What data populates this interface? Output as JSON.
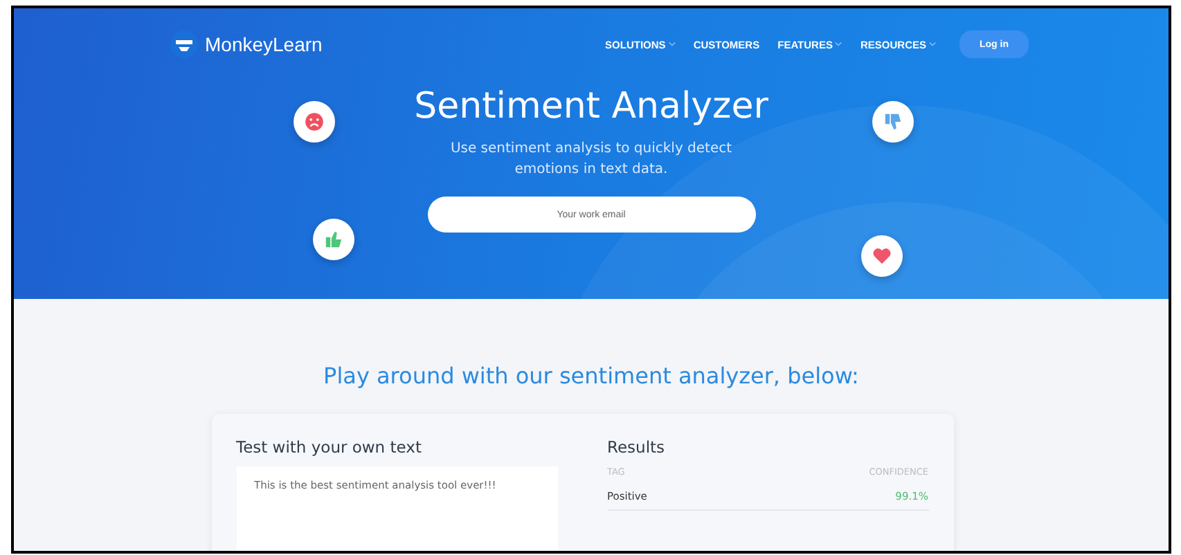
{
  "header": {
    "logo": "MonkeyLearn",
    "nav": [
      {
        "label": "SOLUTIONS",
        "kind": "dropdown"
      },
      {
        "label": "CUSTOMERS",
        "kind": "link"
      },
      {
        "label": "FEATURES",
        "kind": "dropdown"
      },
      {
        "label": "RESOURCES",
        "kind": "dropdown"
      }
    ],
    "login": "Log in"
  },
  "hero": {
    "title": "Sentiment Analyzer",
    "subtitle": "Use sentiment analysis to quickly detect emotions in text data.",
    "email": {
      "placeholder": "Your work email"
    },
    "badges": [
      {
        "kind": "sad"
      },
      {
        "kind": "thumbs-down"
      },
      {
        "kind": "thumbs-up"
      },
      {
        "kind": "heart"
      }
    ]
  },
  "demo": {
    "heading": "Play around with our sentiment analyzer, below:",
    "input": {
      "title": "Test with your own text",
      "value": "This is the best sentiment analysis tool ever!!!"
    },
    "results": {
      "title": "Results",
      "columns": [
        "TAG",
        "CONFIDENCE"
      ],
      "rows": [
        {
          "tag": "Positive",
          "confidence": "99.1%"
        }
      ]
    }
  }
}
